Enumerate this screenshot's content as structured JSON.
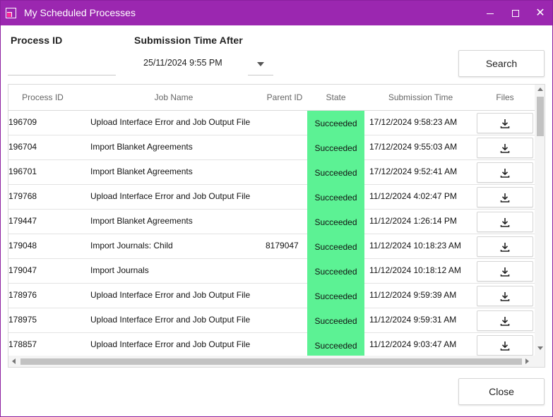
{
  "window": {
    "title": "My Scheduled Processes",
    "accent_color": "#9b27b0"
  },
  "filters": {
    "process_id_label": "Process ID",
    "process_id_value": "",
    "submission_label": "Submission Time After",
    "submission_value": "25/11/2024 9:55 PM"
  },
  "buttons": {
    "search": "Search",
    "close": "Close"
  },
  "grid": {
    "columns": [
      "Process ID",
      "Job Name",
      "Parent ID",
      "State",
      "Submission Time",
      "Files"
    ],
    "state_color": "#5cf294",
    "rows": [
      {
        "pid": "196709",
        "job": "Upload Interface Error and Job Output File",
        "parent": "",
        "state": "Succeeded",
        "time": "17/12/2024 9:58:23 AM"
      },
      {
        "pid": "196704",
        "job": "Import Blanket Agreements",
        "parent": "",
        "state": "Succeeded",
        "time": "17/12/2024 9:55:03 AM"
      },
      {
        "pid": "196701",
        "job": "Import Blanket Agreements",
        "parent": "",
        "state": "Succeeded",
        "time": "17/12/2024 9:52:41 AM"
      },
      {
        "pid": "179768",
        "job": "Upload Interface Error and Job Output File",
        "parent": "",
        "state": "Succeeded",
        "time": "11/12/2024 4:02:47 PM"
      },
      {
        "pid": "179447",
        "job": "Import Blanket Agreements",
        "parent": "",
        "state": "Succeeded",
        "time": "11/12/2024 1:26:14 PM"
      },
      {
        "pid": "179048",
        "job": "Import Journals: Child",
        "parent": "8179047",
        "state": "Succeeded",
        "time": "11/12/2024 10:18:23 AM"
      },
      {
        "pid": "179047",
        "job": "Import Journals",
        "parent": "",
        "state": "Succeeded",
        "time": "11/12/2024 10:18:12 AM"
      },
      {
        "pid": "178976",
        "job": "Upload Interface Error and Job Output File",
        "parent": "",
        "state": "Succeeded",
        "time": "11/12/2024 9:59:39 AM"
      },
      {
        "pid": "178975",
        "job": "Upload Interface Error and Job Output File",
        "parent": "",
        "state": "Succeeded",
        "time": "11/12/2024 9:59:31 AM"
      },
      {
        "pid": "178857",
        "job": "Upload Interface Error and Job Output File",
        "parent": "",
        "state": "Succeeded",
        "time": "11/12/2024 9:03:47 AM"
      }
    ]
  }
}
